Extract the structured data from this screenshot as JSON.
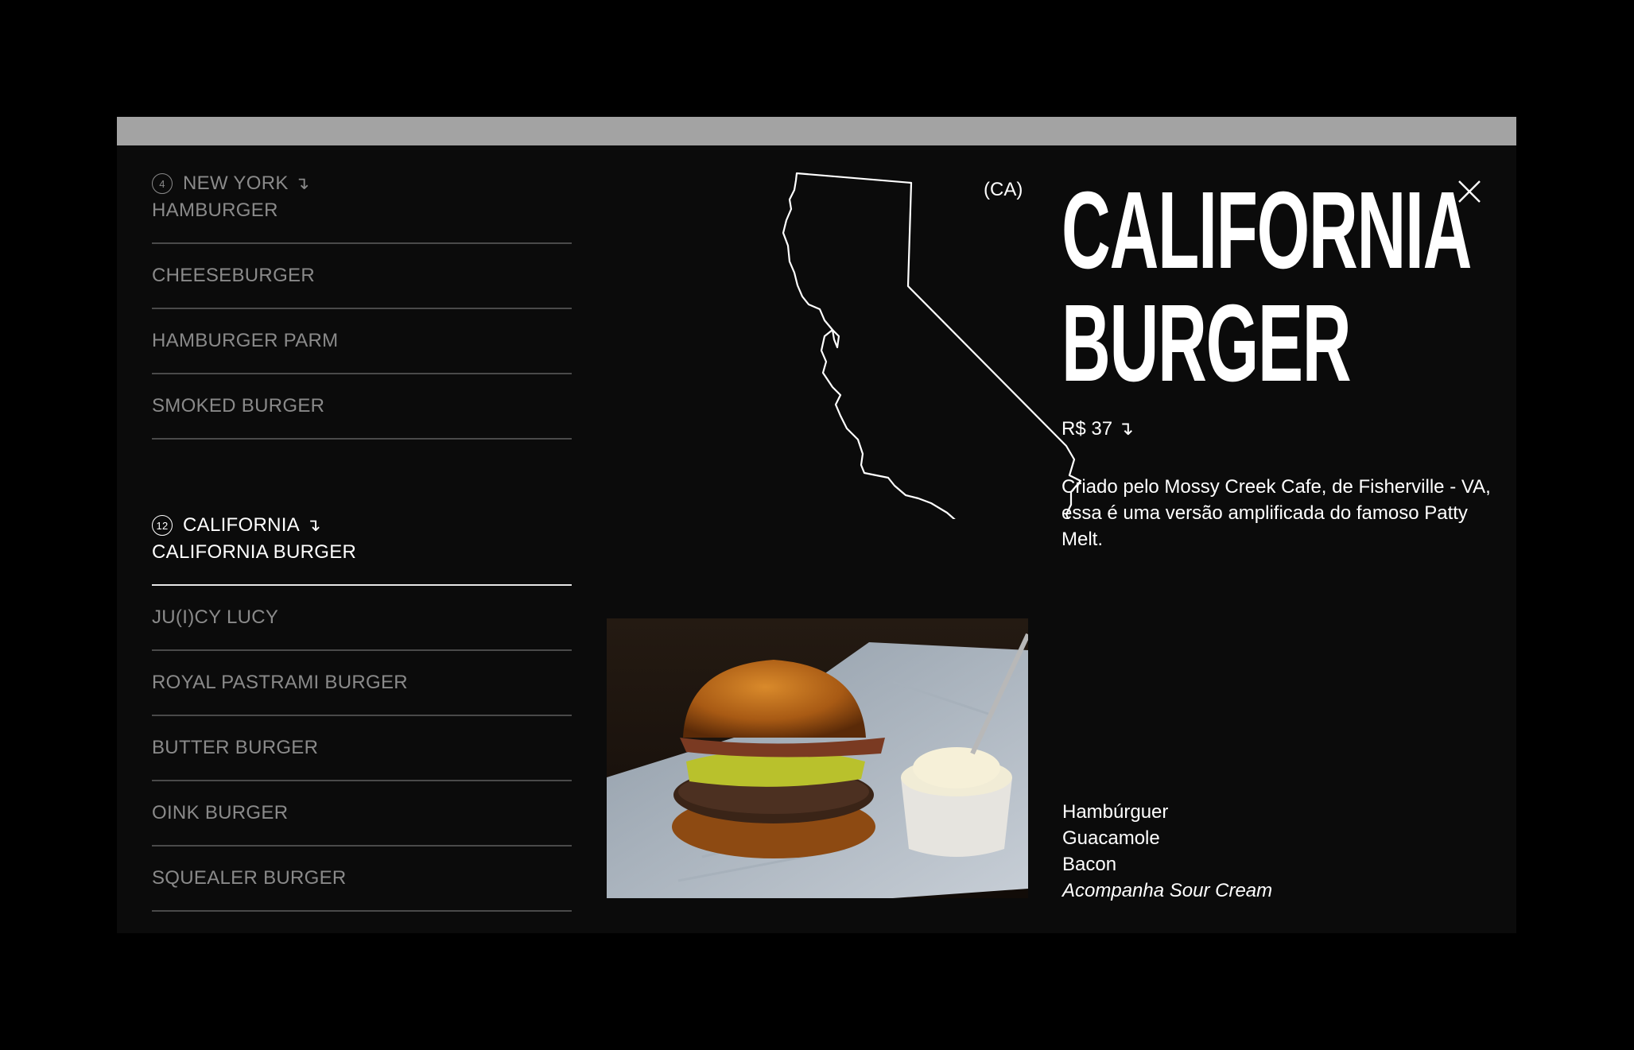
{
  "menu": {
    "groups": [
      {
        "count": "4",
        "state": "NEW YORK",
        "items": [
          "HAMBURGER",
          "CHEESEBURGER",
          "HAMBURGER PARM",
          "SMOKED BURGER"
        ]
      },
      {
        "count": "12",
        "state": "CALIFORNIA",
        "items": [
          "CALIFORNIA BURGER",
          "JU(I)CY LUCY",
          "ROYAL PASTRAMI BURGER",
          "BUTTER BURGER",
          "OINK BURGER",
          "SQUEALER BURGER"
        ]
      }
    ],
    "arrow_glyph": "↴",
    "active_item": "CALIFORNIA BURGER"
  },
  "detail": {
    "state_abbr": "(CA)",
    "title_line1": "CALIFORNIA",
    "title_line2": "BURGER",
    "price": "R$ 37",
    "price_arrow": "↴",
    "description": "Criado pelo Mossy Creek Cafe, de Fisherville - VA, essa é uma versão amplificada do famoso Patty Melt.",
    "ingredients": [
      "Hambúrguer",
      "Guacamole",
      "Bacon"
    ],
    "side_note": "Acompanha Sour Cream"
  },
  "icons": {
    "close": "close-icon",
    "map": "california-map-icon",
    "arrow": "arrow-down-right-icon"
  },
  "colors": {
    "background": "#000000",
    "panel": "#0b0b0b",
    "titlebar": "#a3a3a3",
    "text": "#ffffff",
    "muted": "#8a8a8a",
    "divider": "#4a4a4a"
  }
}
